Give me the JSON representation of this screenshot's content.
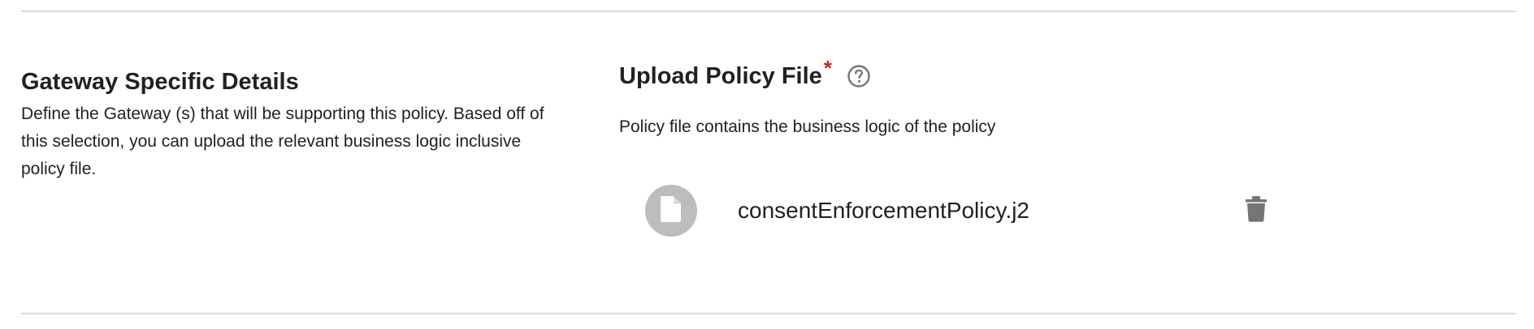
{
  "gateway_section": {
    "title": "Gateway Specific Details",
    "description": "Define the Gateway (s) that will be supporting this policy. Based off of this selection, you can upload the relevant business logic inclusive policy file."
  },
  "upload_section": {
    "title": "Upload Policy File",
    "required_marker": "*",
    "help_icon": "help-circle-icon",
    "description": "Policy file contains the business logic of the policy",
    "file": {
      "name": "consentEnforcementPolicy.j2",
      "icon": "file-icon",
      "delete_icon": "trash-icon"
    }
  },
  "colors": {
    "required": "#c62828",
    "icon_gray": "#757575",
    "avatar_bg": "#bdbdbd",
    "divider": "#dcdcdc"
  }
}
